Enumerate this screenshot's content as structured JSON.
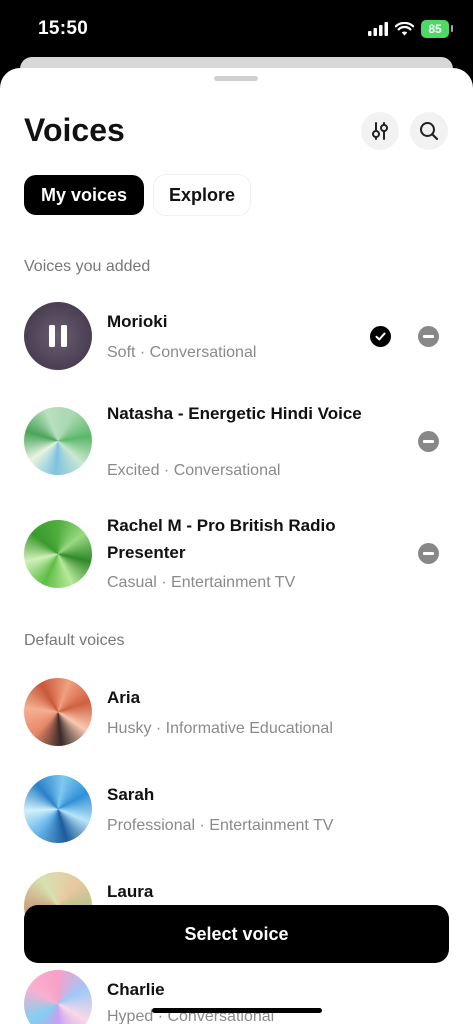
{
  "status": {
    "time": "15:50",
    "battery": "85"
  },
  "header": {
    "title": "Voices"
  },
  "tabs": {
    "my_voices": "My voices",
    "explore": "Explore"
  },
  "sections": {
    "added": "Voices you added",
    "default": "Default voices"
  },
  "added_voices": [
    {
      "name": "Morioki",
      "desc": "Soft · Conversational",
      "state": "playing",
      "selected": true
    },
    {
      "name": "Natasha - Energetic Hindi Voice",
      "desc": "Excited · Conversational"
    },
    {
      "name": "Rachel M - Pro British Radio Presenter",
      "desc": "Casual · Entertainment TV"
    }
  ],
  "default_voices": [
    {
      "name": "Aria",
      "desc": "Husky · Informative Educational"
    },
    {
      "name": "Sarah",
      "desc": "Professional · Entertainment TV"
    },
    {
      "name": "Laura",
      "desc": ""
    },
    {
      "name": "Charlie",
      "desc": "Hyped · Conversational"
    }
  ],
  "actions": {
    "select": "Select voice"
  },
  "icons": {
    "filter": "sliders-icon",
    "search": "search-icon",
    "check": "checkmark-icon",
    "remove": "remove-icon",
    "pause": "pause-icon"
  },
  "colors": {
    "accent": "#000000",
    "battery": "#4cd964"
  }
}
